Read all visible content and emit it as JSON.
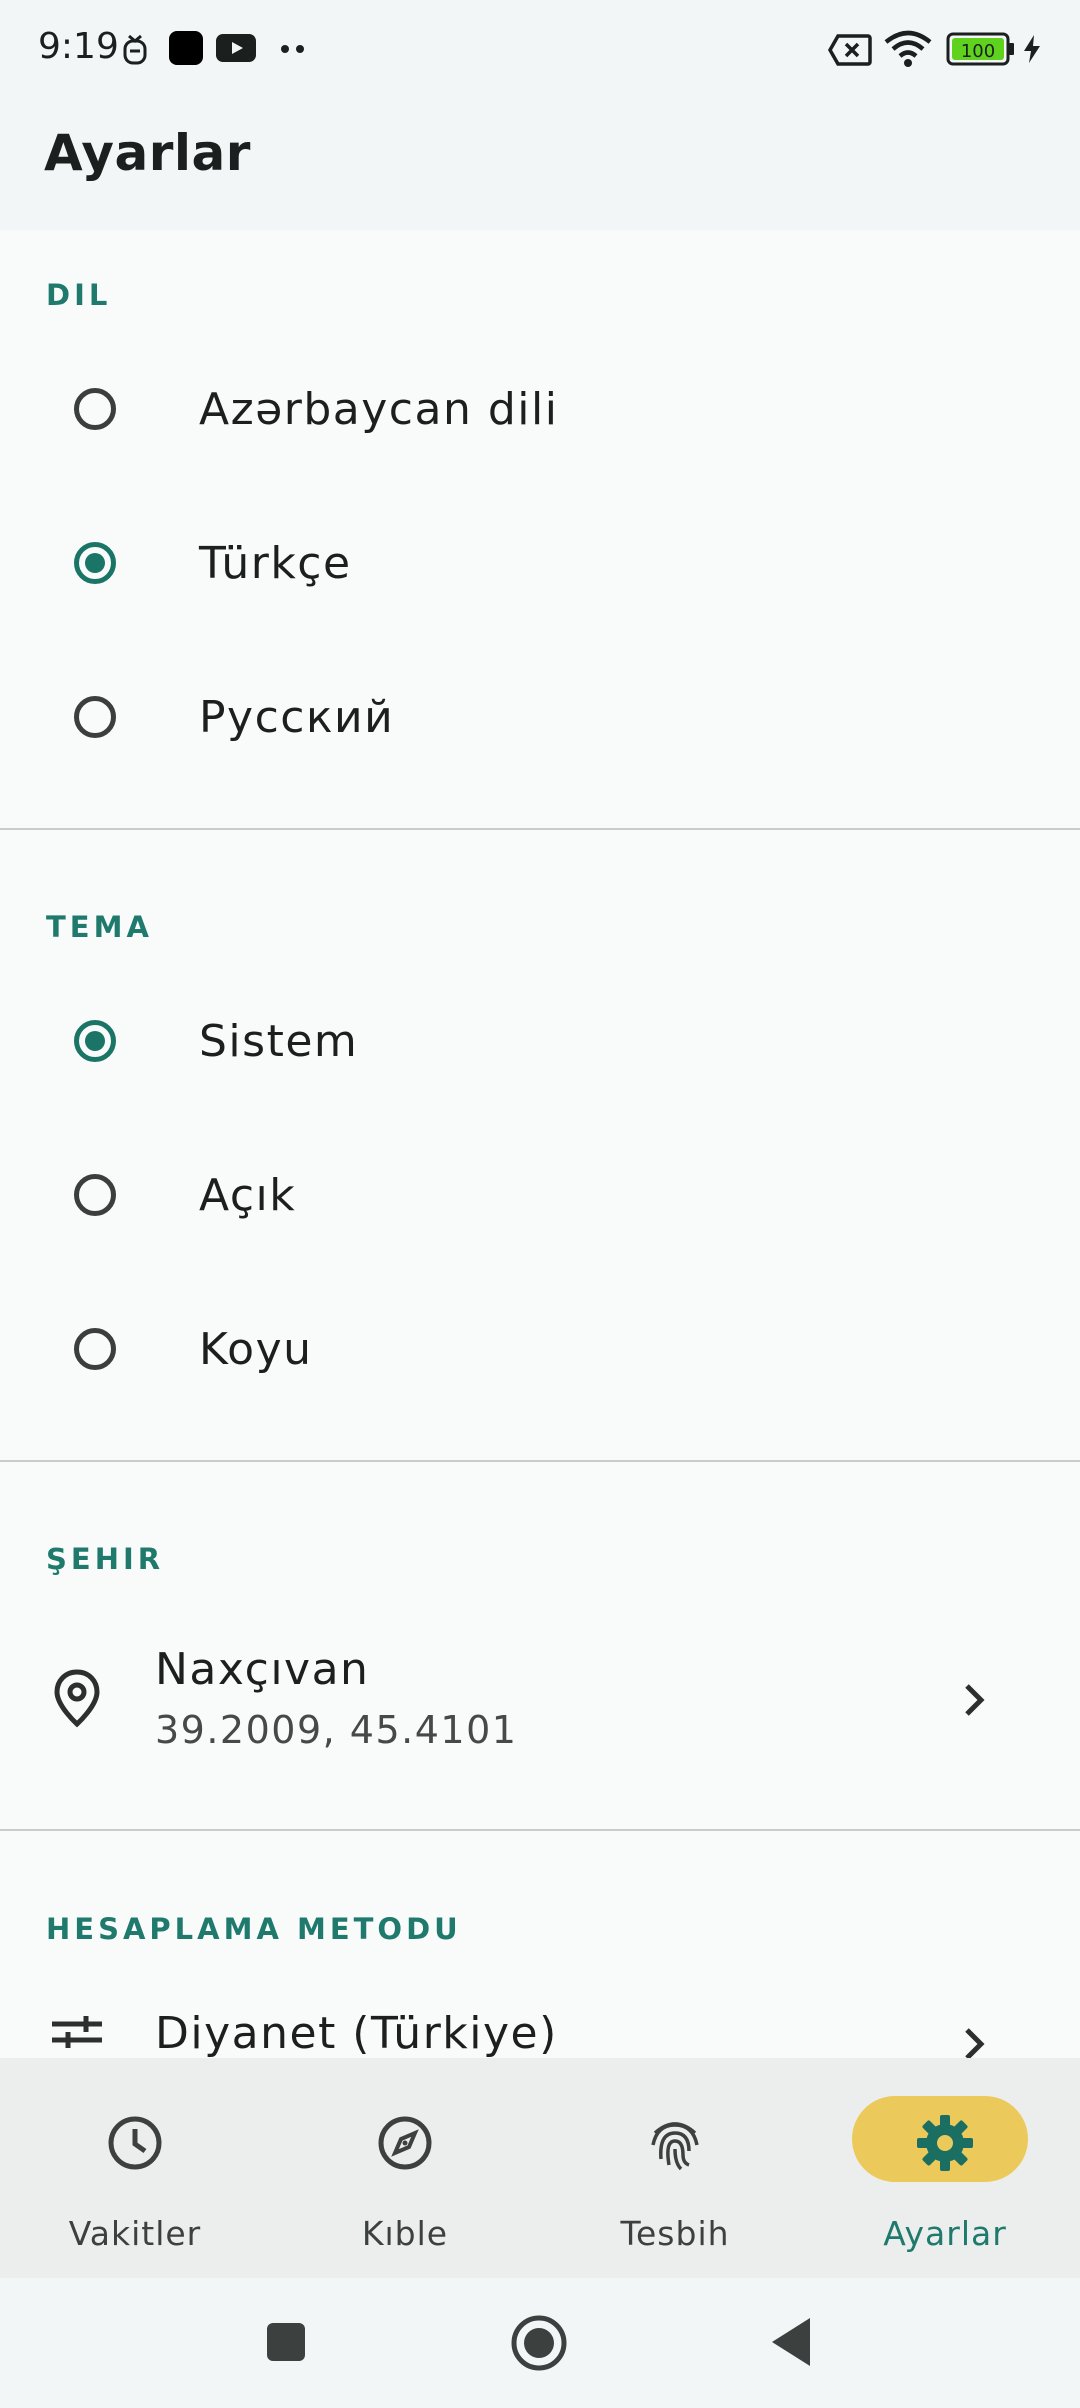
{
  "status_bar": {
    "time": "9:19",
    "battery": "100"
  },
  "app_bar": {
    "title": "Ayarlar"
  },
  "language_section": {
    "header": "DIL",
    "options": [
      {
        "label": "Azərbaycan dili",
        "selected": false
      },
      {
        "label": "Türkçe",
        "selected": true
      },
      {
        "label": "Русский",
        "selected": false
      }
    ]
  },
  "theme_section": {
    "header": "TEMA",
    "options": [
      {
        "label": "Sistem",
        "selected": true
      },
      {
        "label": "Açık",
        "selected": false
      },
      {
        "label": "Koyu",
        "selected": false
      }
    ]
  },
  "city_section": {
    "header": "ŞEHIR",
    "city": "Naxçıvan",
    "coordinates": "39.2009, 45.4101"
  },
  "method_section": {
    "header": "HESAPLAMA METODU",
    "method": "Diyanet (Türkiye)"
  },
  "bottom_nav": {
    "tabs": [
      {
        "label": "Vakitler",
        "icon": "clock-icon",
        "active": false
      },
      {
        "label": "Kıble",
        "icon": "compass-icon",
        "active": false
      },
      {
        "label": "Tesbih",
        "icon": "fingerprint-icon",
        "active": false
      },
      {
        "label": "Ayarlar",
        "icon": "gear-icon",
        "active": true
      }
    ]
  },
  "colors": {
    "accent": "#1f7a6d",
    "active_pill": "#ebc95a",
    "battery_fill": "#5fd21e"
  }
}
